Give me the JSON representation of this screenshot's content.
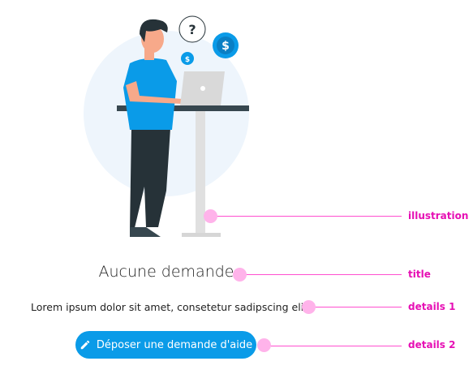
{
  "empty_state": {
    "title": "Aucune demande",
    "details": "Lorem ipsum dolor sit amet, consetetur sadipscing elitr",
    "button": {
      "label": "Déposer une demande d'aide",
      "icon": "pencil-icon"
    },
    "accent_color": "#0a9be8"
  },
  "annotations": {
    "illustration": "illustration",
    "title": "title",
    "details1": "details 1",
    "details2": "details 2"
  },
  "illustration": {
    "question_mark": "?",
    "coin_symbol": "$"
  }
}
